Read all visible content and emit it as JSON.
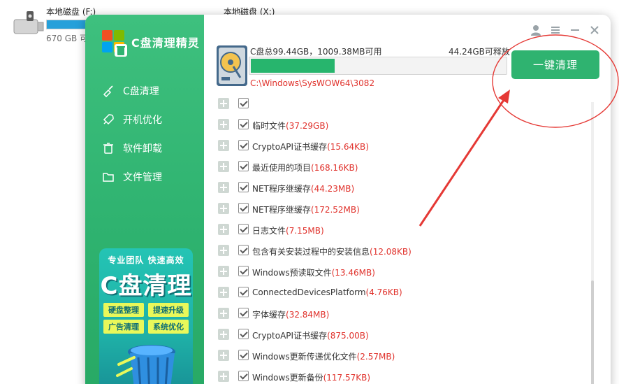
{
  "explorer": {
    "drive_f_name": "本地磁盘 (F:)",
    "drive_f_size": "670 GB 可",
    "drive_x_name": "本地磁盘 (X:)"
  },
  "app": {
    "title": "C盘清理精灵"
  },
  "sidebar": {
    "items": [
      {
        "label": "C盘清理",
        "icon": "broom-icon"
      },
      {
        "label": "开机优化",
        "icon": "rocket-icon"
      },
      {
        "label": "软件卸载",
        "icon": "trash-icon"
      },
      {
        "label": "文件管理",
        "icon": "folder-icon"
      }
    ]
  },
  "promo": {
    "tagline": "专业团队  快速高效",
    "headline": "C盘清理",
    "tags": [
      "硬盘整理",
      "提速升级",
      "广告清理",
      "系统优化"
    ]
  },
  "status": {
    "disk_info": "C盘总99.44GB，1009.38MB可用",
    "releasable": "44.24GB可释放",
    "progress_fraction": 0.33,
    "current_path": "C:\\Windows\\SysWOW64\\3082",
    "clean_button": "一键清理"
  },
  "list": {
    "items": [
      {
        "name": "临时文件",
        "size": "(37.29GB)"
      },
      {
        "name": "CryptoAPI证书缓存",
        "size": "(15.64KB)"
      },
      {
        "name": "最近使用的项目",
        "size": "(168.16KB)"
      },
      {
        "name": "NET程序继缓存",
        "size": "(44.23MB)"
      },
      {
        "name": "NET程序继缓存",
        "size": "(172.52MB)"
      },
      {
        "name": "日志文件",
        "size": "(7.15MB)"
      },
      {
        "name": "包含有关安装过程中的安装信息",
        "size": "(12.08KB)"
      },
      {
        "name": "Windows预读取文件",
        "size": "(13.46MB)"
      },
      {
        "name": "ConnectedDevicesPlatform",
        "size": "(4.76KB)"
      },
      {
        "name": "字体缓存",
        "size": "(32.84MB)"
      },
      {
        "name": "CryptoAPI证书缓存",
        "size": "(875.00B)"
      },
      {
        "name": "Windows更新传递优化文件",
        "size": "(2.57MB)"
      },
      {
        "name": "Windows更新备份",
        "size": "(117.57KB)"
      }
    ]
  },
  "colors": {
    "accent": "#2fb370",
    "highlight": "#e0312b",
    "annotation": "#e53935"
  }
}
